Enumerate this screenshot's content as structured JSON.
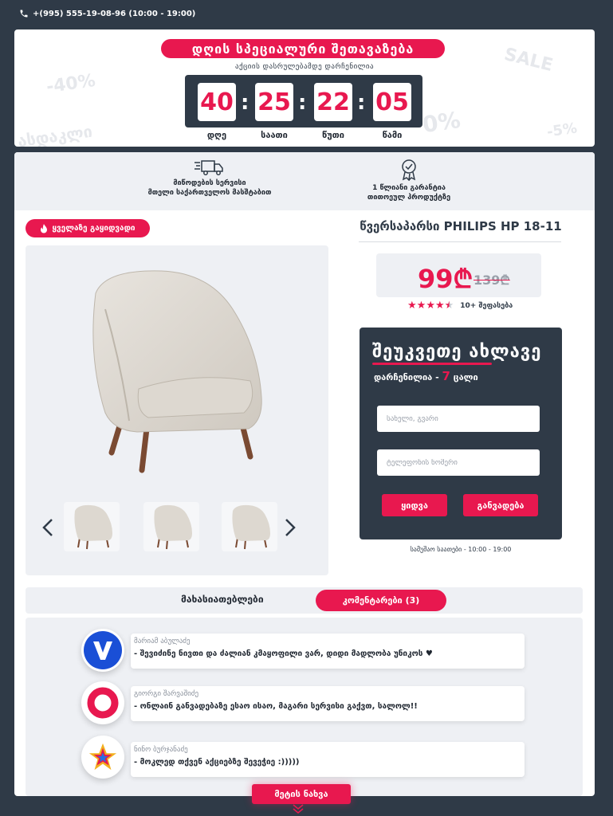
{
  "topbar": {
    "phone": "+(995) 555-19-08-96 (10:00 - 19:00)",
    "phone_icon": "phone-icon"
  },
  "offer": {
    "title": "დღის სპეციალური შეთავაზება",
    "subtitle": "აქციის დასრულებამდე დარჩენილია",
    "decor": [
      "SALE",
      "-40%",
      "-5%",
      "0%",
      "ასდაკლი"
    ],
    "countdown": [
      {
        "value": "40",
        "label": "დღე"
      },
      {
        "value": "25",
        "label": "საათი"
      },
      {
        "value": "22",
        "label": "წუთი"
      },
      {
        "value": "05",
        "label": "წამი"
      }
    ]
  },
  "benefits": [
    {
      "icon": "delivery-truck-icon",
      "line1": "მიწოდების სერვისი",
      "line2": "მთელი საქართველოს მასშტაბით"
    },
    {
      "icon": "warranty-badge-icon",
      "line1": "1 წლიანი გარანტია",
      "line2": "თითოეულ პროდუქტზე"
    }
  ],
  "product": {
    "badge": "ყველაზე გაყიდვადი",
    "badge_icon": "fire-icon",
    "title": "წვერსაპარსი PHILIPS HP 18-11",
    "price": "99₾",
    "old_price": "139₾",
    "rating": 4.5,
    "rating_max": 5,
    "reviews": "10+ შეფასება",
    "thumbnails": [
      "armchair-thumb-1",
      "armchair-thumb-2",
      "armchair-thumb-3"
    ]
  },
  "order": {
    "title": "შეუკვეთე ახლავე",
    "stock_label": "დარჩენილია - ",
    "stock_count": "7",
    "stock_unit": " ცალი",
    "name_placeholder": "სახელი, გვარი",
    "phone_placeholder": "ტელეფონის ნომერი",
    "buy_label": "ყიდვა",
    "installment_label": "განვადება",
    "hours": "სამუშაო საათები - 10:00 - 19:00"
  },
  "tabs": {
    "specs": "მახასიათებლები",
    "comments": "კომენტარები (3)"
  },
  "comments": [
    {
      "name": "მარიამ აბულაძე",
      "text": "- შევიძინე ნივთი და ძალიან კმაყოფილი ვარ, დიდი მადლობა უნიკოს ♥",
      "avatar": "v-logo-icon"
    },
    {
      "name": "გიორგი შარვაშიძე",
      "text": "- ონლაინ განვადებაზე ესაო ისაო, მაგარი სერვისი გაქვთ, სალოლ!!",
      "avatar": "ring-logo-icon"
    },
    {
      "name": "ნინო ბურჯანაძე",
      "text": "- მოკლედ თქვენ აქციებზე შევეჭიე :)))))",
      "avatar": "star-logo-icon"
    }
  ],
  "more": {
    "label": "მეტის ნახვა"
  },
  "colors": {
    "accent": "#e8184f",
    "dark": "#2f3a47",
    "light": "#eef0f4"
  }
}
